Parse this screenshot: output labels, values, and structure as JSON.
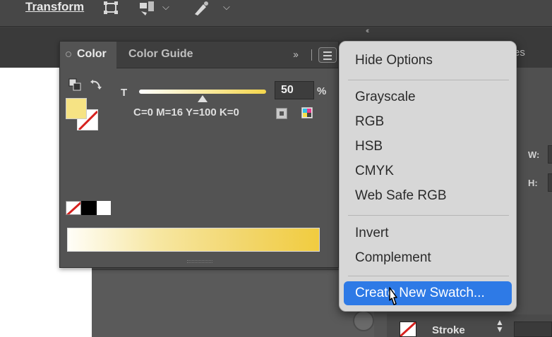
{
  "toolbar": {
    "transform_label": "Transform",
    "icons": [
      "transform-bounds-icon",
      "align-icon",
      "recolor-icon"
    ]
  },
  "color_panel": {
    "tabs": [
      {
        "label": "Color",
        "active": true
      },
      {
        "label": "Color Guide",
        "active": false
      }
    ],
    "tint_label": "T",
    "tint_value": "50",
    "tint_unit": "%",
    "tint_fraction": 0.5,
    "cmyk_readout": "C=0 M=16 Y=100 K=0",
    "fill_color": "#f6e384",
    "spectrum_colors": [
      "#fffef8",
      "#f1cc3f"
    ]
  },
  "flyout_menu": {
    "groups": [
      [
        "Hide Options"
      ],
      [
        "Grayscale",
        "RGB",
        "HSB",
        "CMYK",
        "Web Safe RGB"
      ],
      [
        "Invert",
        "Complement"
      ]
    ],
    "highlighted_item": "Create New Swatch..."
  },
  "right_panel": {
    "partial_tab": "es",
    "w_label": "W:",
    "h_label": "H:",
    "stroke_label": "Stroke"
  },
  "colors": {
    "menu_highlight": "#2e7ae6",
    "panel_bg": "#535353",
    "menu_bg": "#d7d7d7"
  }
}
